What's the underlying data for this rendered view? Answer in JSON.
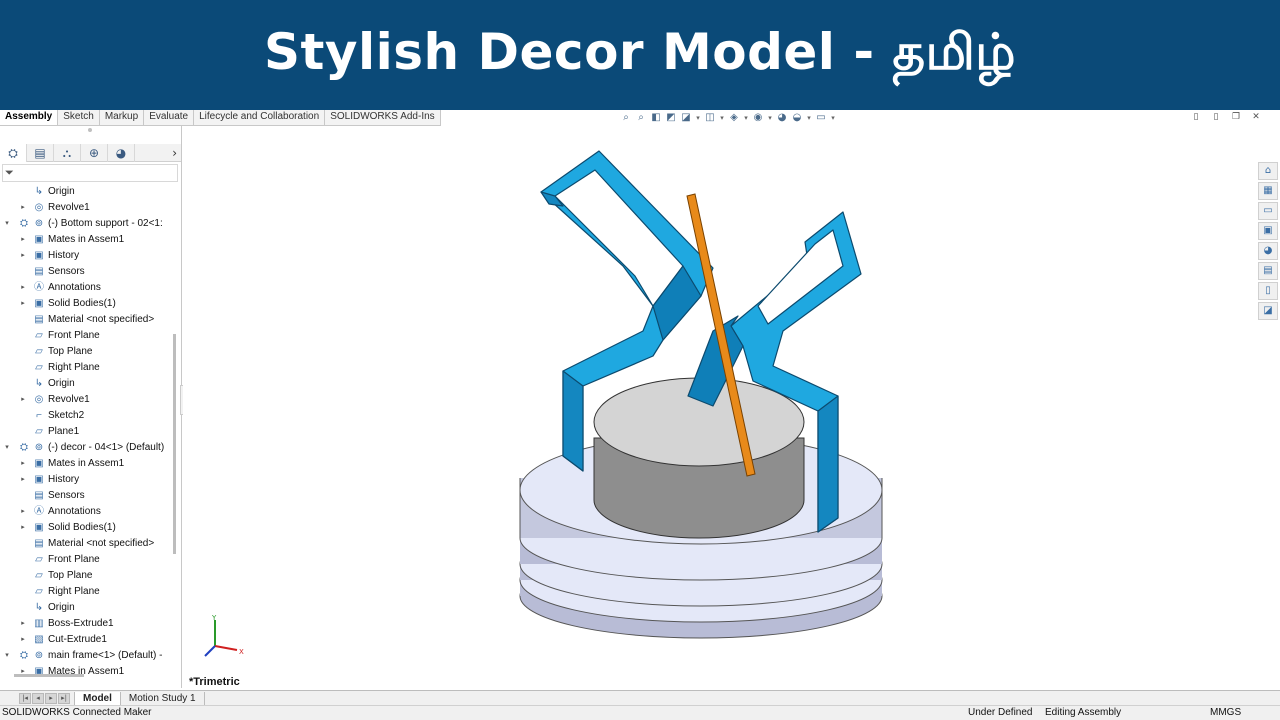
{
  "banner": {
    "title": "Stylish Decor Model -  தமிழ்"
  },
  "command_tabs": [
    "Assembly",
    "Sketch",
    "Markup",
    "Evaluate",
    "Lifecycle and Collaboration",
    "SOLIDWORKS Add-Ins"
  ],
  "view_toolbar": [
    "zoom-to-fit-icon",
    "zoom-area-icon",
    "previous-view-icon",
    "section-view-icon",
    "dynamic-annotation-icon",
    "view-orientation-icon",
    "display-style-icon",
    "hide-show-icon",
    "edit-appearance-icon",
    "apply-scene-icon",
    "view-settings-icon"
  ],
  "feature_manager": {
    "tabs": [
      "featuremanager-tree-icon",
      "property-manager-icon",
      "configuration-manager-icon",
      "dimxpert-icon",
      "display-manager-icon"
    ],
    "tree": [
      {
        "label": "Origin",
        "level": 1,
        "icon": "origin-icon",
        "expand": false
      },
      {
        "label": "Revolve1",
        "level": 1,
        "icon": "revolve-icon",
        "expand": true
      },
      {
        "label": "(-) Bottom support - 02<1:",
        "level": 0,
        "icon": "part-icon",
        "expand": true,
        "open": true
      },
      {
        "label": "Mates in Assem1",
        "level": 1,
        "icon": "mates-folder-icon",
        "expand": true
      },
      {
        "label": "History",
        "level": 1,
        "icon": "history-folder-icon",
        "expand": true
      },
      {
        "label": "Sensors",
        "level": 1,
        "icon": "sensors-icon",
        "expand": false
      },
      {
        "label": "Annotations",
        "level": 1,
        "icon": "annotations-icon",
        "expand": true
      },
      {
        "label": "Solid Bodies(1)",
        "level": 1,
        "icon": "solid-bodies-icon",
        "expand": true
      },
      {
        "label": "Material <not specified>",
        "level": 1,
        "icon": "material-icon",
        "expand": false
      },
      {
        "label": "Front Plane",
        "level": 1,
        "icon": "plane-icon",
        "expand": false
      },
      {
        "label": "Top Plane",
        "level": 1,
        "icon": "plane-icon",
        "expand": false
      },
      {
        "label": "Right Plane",
        "level": 1,
        "icon": "plane-icon",
        "expand": false
      },
      {
        "label": "Origin",
        "level": 1,
        "icon": "origin-icon",
        "expand": false
      },
      {
        "label": "Revolve1",
        "level": 1,
        "icon": "revolve-icon",
        "expand": true
      },
      {
        "label": "Sketch2",
        "level": 1,
        "icon": "sketch-icon",
        "expand": false
      },
      {
        "label": "Plane1",
        "level": 1,
        "icon": "plane-icon",
        "expand": false
      },
      {
        "label": "(-) decor - 04<1> (Default)",
        "level": 0,
        "icon": "part-icon",
        "expand": true,
        "open": true
      },
      {
        "label": "Mates in Assem1",
        "level": 1,
        "icon": "mates-folder-icon",
        "expand": true
      },
      {
        "label": "History",
        "level": 1,
        "icon": "history-folder-icon",
        "expand": true
      },
      {
        "label": "Sensors",
        "level": 1,
        "icon": "sensors-icon",
        "expand": false
      },
      {
        "label": "Annotations",
        "level": 1,
        "icon": "annotations-icon",
        "expand": true
      },
      {
        "label": "Solid Bodies(1)",
        "level": 1,
        "icon": "solid-bodies-icon",
        "expand": true
      },
      {
        "label": "Material <not specified>",
        "level": 1,
        "icon": "material-icon",
        "expand": false
      },
      {
        "label": "Front Plane",
        "level": 1,
        "icon": "plane-icon",
        "expand": false
      },
      {
        "label": "Top Plane",
        "level": 1,
        "icon": "plane-icon",
        "expand": false
      },
      {
        "label": "Right Plane",
        "level": 1,
        "icon": "plane-icon",
        "expand": false
      },
      {
        "label": "Origin",
        "level": 1,
        "icon": "origin-icon",
        "expand": false
      },
      {
        "label": "Boss-Extrude1",
        "level": 1,
        "icon": "boss-extrude-icon",
        "expand": true
      },
      {
        "label": "Cut-Extrude1",
        "level": 1,
        "icon": "cut-extrude-icon",
        "expand": true
      },
      {
        "label": "main frame<1> (Default) -",
        "level": 0,
        "icon": "part-icon",
        "expand": true,
        "open": true
      },
      {
        "label": "Mates in Assem1",
        "level": 1,
        "icon": "mates-folder-icon",
        "expand": true
      }
    ]
  },
  "viewport": {
    "view_name": "*Trimetric",
    "colors": {
      "frame": "#1fa8e0",
      "frame_dark": "#1487c0",
      "rod": "#e88a1a",
      "cylinder": "#9a9a9a",
      "base_disc": "#e4e8f8"
    },
    "triad_axes": {
      "x": "X",
      "y": "Y"
    }
  },
  "task_pane": [
    "solidworks-resources-icon",
    "design-library-icon",
    "file-explorer-icon",
    "view-palette-icon",
    "appearances-icon",
    "custom-properties-icon",
    "solidworks-forum-icon",
    "solidworks-3dexperience-icon"
  ],
  "bottom_tabs": [
    "Model",
    "Motion Study 1"
  ],
  "status": {
    "left": "SOLIDWORKS Connected Maker",
    "definition": "Under Defined",
    "mode": "Editing Assembly",
    "units": "MMGS"
  }
}
